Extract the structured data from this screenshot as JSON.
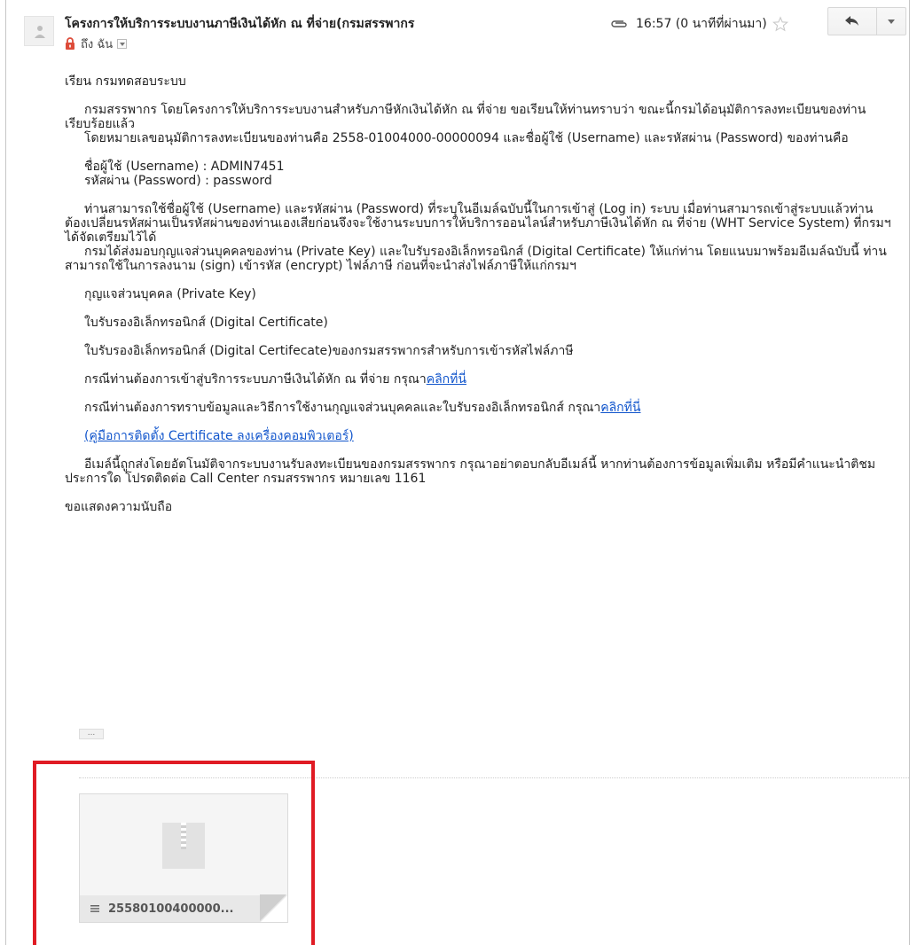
{
  "header": {
    "subject": "โครงการให้บริการระบบงานภาษีเงินได้หัก ณ ที่จ่าย(กรมสรรพากร",
    "recipient": "ถึง ฉัน",
    "time": "16:57 (0 นาทีที่ผ่านมา)"
  },
  "body": {
    "greeting": "เรียน กรมทดสอบระบบ",
    "p1": "กรมสรรพากร โดยโครงการให้บริการระบบงานสำหรับภาษีหักเงินได้หัก ณ ที่จ่าย ขอเรียนให้ท่านทราบว่า ขณะนี้กรมได้อนุมัติการลงทะเบียนของท่านเรียบร้อยแล้ว",
    "p2": "โดยหมายเลขอนุมัติการลงทะเบียนของท่านคือ 2558-01004000-00000094 และชื่อผู้ใช้ (Username) และรหัสผ่าน (Password) ของท่านคือ",
    "username_line": "ชื่อผู้ใช้ (Username) : ADMIN7451",
    "password_line": "รหัสผ่าน (Password) : password",
    "p3": "ท่านสามารถใช้ชื่อผู้ใช้ (Username) และรหัสผ่าน (Password) ที่ระบุในอีเมล์ฉบับนี้ในการเข้าสู่ (Log in) ระบบ เมื่อท่านสามารถเข้าสู่ระบบแล้วท่านต้องเปลี่ยนรหัสผ่านเป็นรหัสผ่านของท่านเองเสียก่อนจึงจะใช้งานระบบการให้บริการออนไลน์สำหรับภาษีเงินได้หัก ณ ที่จ่าย (WHT Service System) ที่กรมฯ ได้จัดเตรียมไว้ได้",
    "p4": "กรมได้ส่งมอบกุญแจส่วนบุคคลของท่าน (Private Key) และใบรับรองอิเล็กทรอนิกส์ (Digital Certificate) ให้แก่ท่าน โดยแนบมาพร้อมอีเมล์ฉบับนี้ ท่านสามารถใช้ในการลงนาม (sign) เข้ารหัส (encrypt) ไฟล์ภาษี ก่อนที่จะนำส่งไฟล์ภาษีให้แก่กรมฯ",
    "item1": "กุญแจส่วนบุคคล (Private Key)",
    "item2": "ใบรับรองอิเล็กทรอนิกส์ (Digital Certificate)",
    "item3": "ใบรับรองอิเล็กทรอนิกส์ (Digital Certifecate)ของกรมสรรพากรสำหรับการเข้ารหัสไฟล์ภาษี",
    "line_access": "กรณีท่านต้องการเข้าสู่บริการระบบภาษีเงินได้หัก ณ ที่จ่าย กรุณา",
    "link_access": "คลิกที่นี่",
    "line_info": "กรณีท่านต้องการทราบข้อมูลและวิธีการใช้งานกุญแจส่วนบุคคลและใบรับรองอิเล็กทรอนิกส์ กรุณา",
    "link_info": "คลิกที่นี่",
    "link_manual": "(คู่มือการติดตั้ง Certificate ลงเครื่องคอมพิวเตอร์)",
    "p5": "อีเมล์นี้ถูกส่งโดยอัตโนมัติจากระบบงานรับลงทะเบียนของกรมสรรพากร กรุณาอย่าตอบกลับอีเมล์นี้ หากท่านต้องการข้อมูลเพิ่มเติม หรือมีคำแนะนำติชมประการใด โปรดติดต่อ Call Center กรมสรรพากร หมายเลข 1161",
    "closing": "ขอแสดงความนับถือ",
    "trimmed": "..."
  },
  "attachment": {
    "filename": "25580100400000..."
  },
  "colors": {
    "link": "#1155cc",
    "highlight": "#e01b24",
    "lock": "#dd4b39"
  },
  "icons": [
    "avatar-icon",
    "lock-icon",
    "paperclip-icon",
    "star-icon",
    "reply-icon",
    "chevron-down-icon",
    "zip-file-icon",
    "file-lines-icon"
  ]
}
